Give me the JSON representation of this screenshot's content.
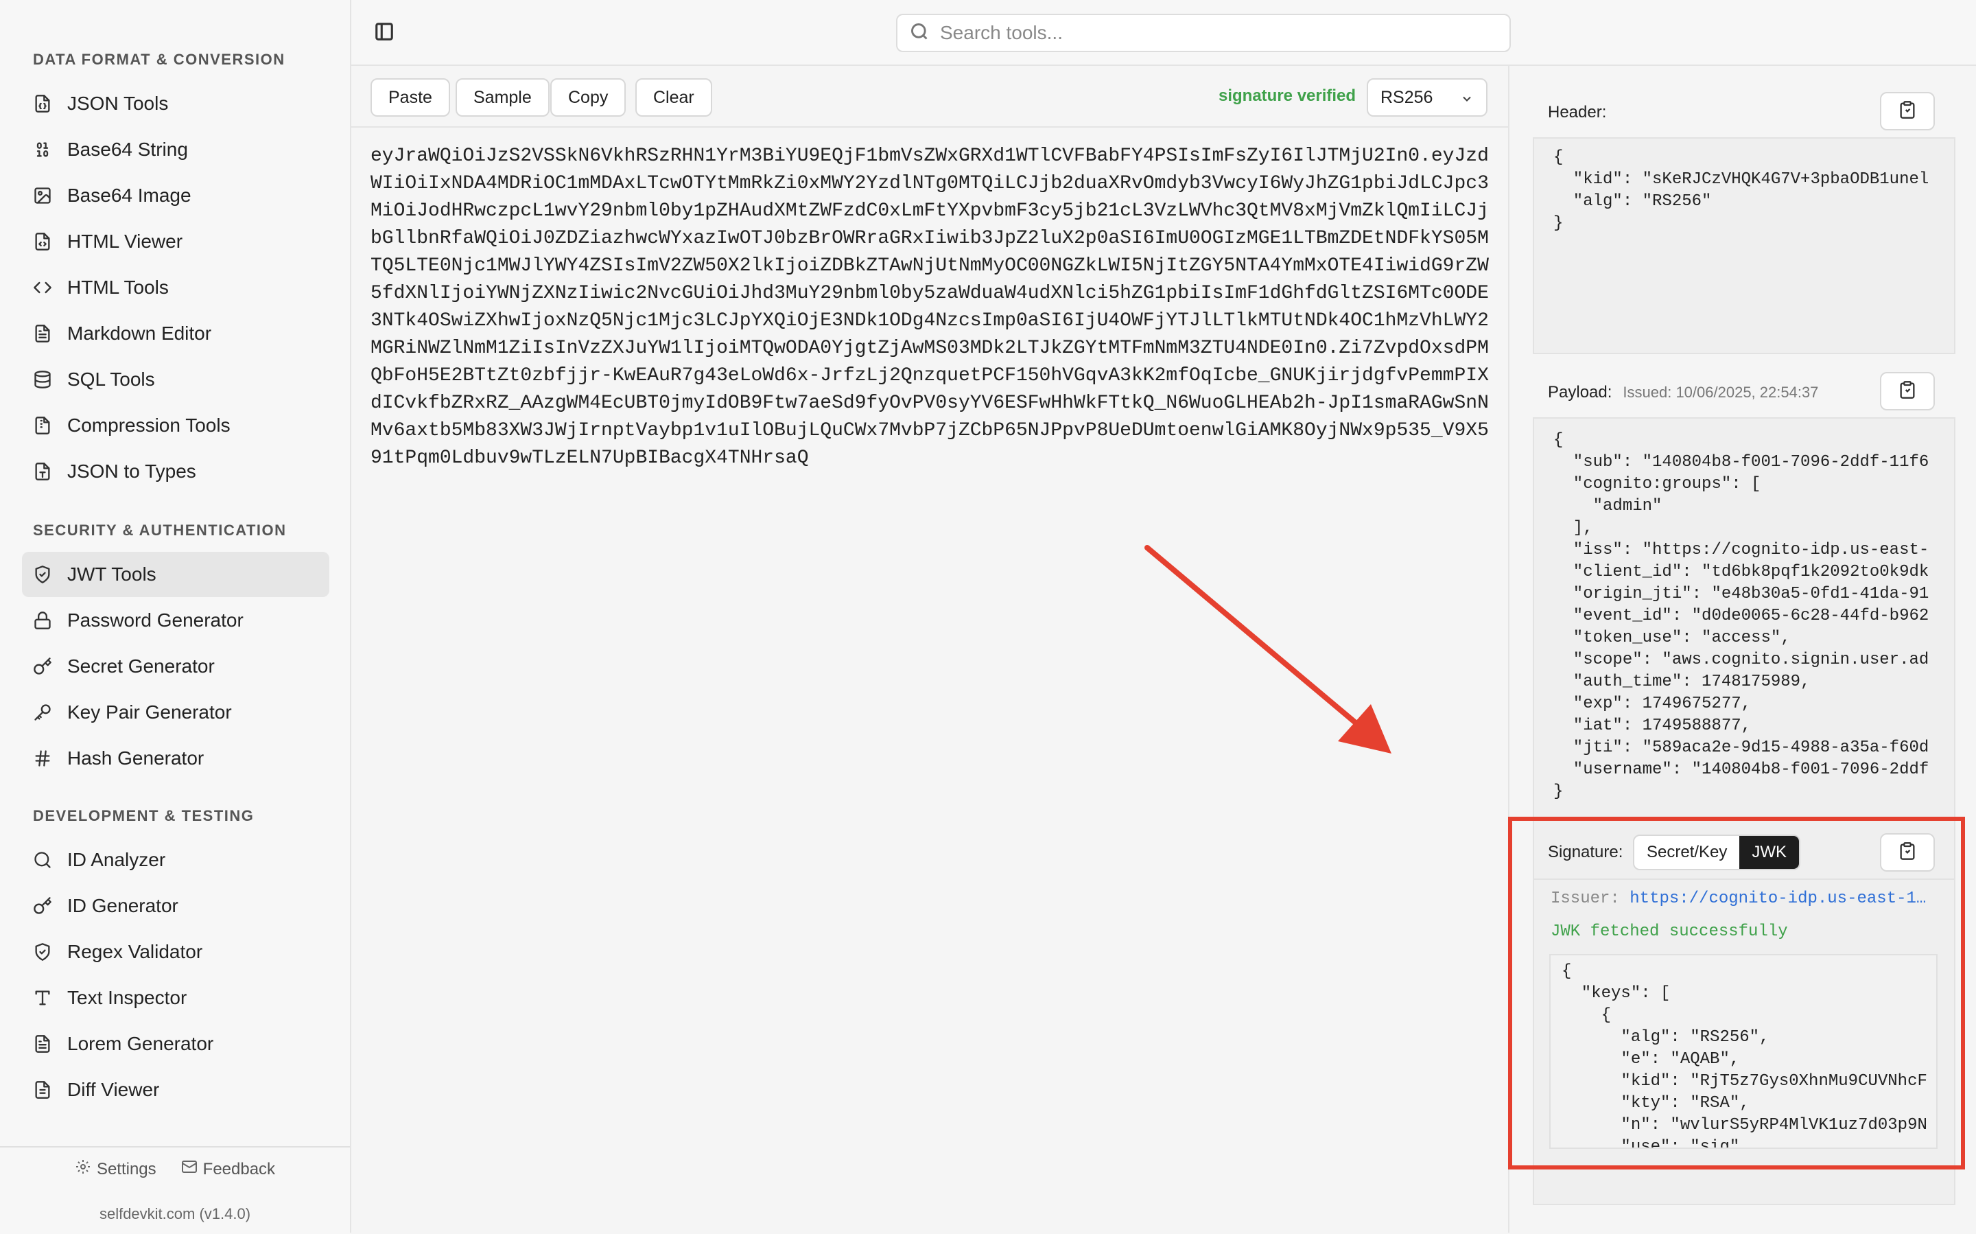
{
  "sidebar": {
    "sections": [
      {
        "title": "DATA FORMAT & CONVERSION",
        "items": [
          {
            "label": "JSON Tools",
            "icon": "file-json-icon"
          },
          {
            "label": "Base64 String",
            "icon": "binary-icon"
          },
          {
            "label": "Base64 Image",
            "icon": "image-icon"
          },
          {
            "label": "HTML Viewer",
            "icon": "file-code-icon"
          },
          {
            "label": "HTML Tools",
            "icon": "code-icon"
          },
          {
            "label": "Markdown Editor",
            "icon": "file-text-icon"
          },
          {
            "label": "SQL Tools",
            "icon": "database-icon"
          },
          {
            "label": "Compression Tools",
            "icon": "archive-icon"
          },
          {
            "label": "JSON to Types",
            "icon": "file-type-icon"
          }
        ]
      },
      {
        "title": "SECURITY & AUTHENTICATION",
        "items": [
          {
            "label": "JWT Tools",
            "icon": "shield-check-icon",
            "active": true
          },
          {
            "label": "Password Generator",
            "icon": "lock-icon"
          },
          {
            "label": "Secret Generator",
            "icon": "key-round-icon"
          },
          {
            "label": "Key Pair Generator",
            "icon": "key-icon"
          },
          {
            "label": "Hash Generator",
            "icon": "hash-icon"
          }
        ]
      },
      {
        "title": "DEVELOPMENT & TESTING",
        "items": [
          {
            "label": "ID Analyzer",
            "icon": "search-icon"
          },
          {
            "label": "ID Generator",
            "icon": "key-round-icon"
          },
          {
            "label": "Regex Validator",
            "icon": "shield-check-icon"
          },
          {
            "label": "Text Inspector",
            "icon": "type-icon"
          },
          {
            "label": "Lorem Generator",
            "icon": "file-text-icon"
          },
          {
            "label": "Diff Viewer",
            "icon": "file-diff-icon"
          }
        ]
      }
    ],
    "footer": {
      "settings": "Settings",
      "feedback": "Feedback",
      "version": "selfdevkit.com (v1.4.0)"
    }
  },
  "search": {
    "placeholder": "Search tools..."
  },
  "toolbar": {
    "paste": "Paste",
    "sample": "Sample",
    "copy": "Copy",
    "clear": "Clear",
    "status": "signature verified",
    "algorithm": "RS256"
  },
  "token": "eyJraWQiOiJzS2VSSkN6VkhRSzRHN1YrM3BiYU9EQjF1bmVsZWxGRXd1WTlCVFBabFY4PSIsImFsZyI6IlJTMjU2In0.eyJzdWIiOiIxNDA4MDRiOC1mMDAxLTcwOTYtMmRkZi0xMWY2YzdlNTg0MTQiLCJjb2duaXRvOmdyb3VwcyI6WyJhZG1pbiJdLCJpc3MiOiJodHRwczpcL1wvY29nbml0by1pZHAudXMtZWFzdC0xLmFtYXpvbmF3cy5jb21cL3VzLWVhc3QtMV8xMjVmZklQmIiLCJjbGllbnRfaWQiOiJ0ZDZiazhwcWYxazIwOTJ0bzBrOWRraGRxIiwib3JpZ2luX2p0aSI6ImU0OGIzMGE1LTBmZDEtNDFkYS05MTQ5LTE0Njc1MWJlYWY4ZSIsImV2ZW50X2lkIjoiZDBkZTAwNjUtNmMyOC00NGZkLWI5NjItZGY5NTA4YmMxOTE4IiwidG9rZW5fdXNlIjoiYWNjZXNzIiwic2NvcGUiOiJhd3MuY29nbml0by5zaWduaW4udXNlci5hZG1pbiIsImF1dGhfdGltZSI6MTc0ODE3NTk4OSwiZXhwIjoxNzQ5Njc1Mjc3LCJpYXQiOjE3NDk1ODg4NzcsImp0aSI6IjU4OWFjYTJlLTlkMTUtNDk4OC1hMzVhLWY2MGRiNWZlNmM1ZiIsInVzZXJuYW1lIjoiMTQwODA0YjgtZjAwMS03MDk2LTJkZGYtMTFmNmM3ZTU4NDE0In0.Zi7ZvpdOxsdPMQbFoH5E2BTtZt0zbfjjr-KwEAuR7g43eLoWd6x-JrfzLj2QnzquetPCF150hVGqvA3kK2mfOqIcbe_GNUKjirjdgfvPemmPIXdICvkfbZRxRZ_AAzgWM4EcUBT0jmyIdOB9Ftw7aeSd9fyOvPV0syYV6ESFwHhWkFTtkQ_N6WuoGLHEAb2h-JpI1smaRAGwSnNMv6axtb5Mb83XW3JWjIrnptVaybp1v1uIlOBujLQuCWx7MvbP7jZCbP65NJPpvP8UeDUmtoenwlGiAMK8OyjNWx9p535_V9X591tPqm0Ldbuv9wTLzELN7UpBIBacgX4TNHrsaQ",
  "header_panel": {
    "label": "Header:",
    "json": "{\n  \"kid\": \"sKeRJCzVHQK4G7V+3pbaODB1unel\n  \"alg\": \"RS256\"\n}"
  },
  "payload_panel": {
    "label": "Payload:",
    "issued": "Issued: 10/06/2025, 22:54:37",
    "json": "{\n  \"sub\": \"140804b8-f001-7096-2ddf-11f6\n  \"cognito:groups\": [\n    \"admin\"\n  ],\n  \"iss\": \"https://cognito-idp.us-east-\n  \"client_id\": \"td6bk8pqf1k2092to0k9dk\n  \"origin_jti\": \"e48b30a5-0fd1-41da-91\n  \"event_id\": \"d0de0065-6c28-44fd-b962\n  \"token_use\": \"access\",\n  \"scope\": \"aws.cognito.signin.user.ad\n  \"auth_time\": 1748175989,\n  \"exp\": 1749675277,\n  \"iat\": 1749588877,\n  \"jti\": \"589aca2e-9d15-4988-a35a-f60d\n  \"username\": \"140804b8-f001-7096-2ddf\n}"
  },
  "signature_panel": {
    "label": "Signature:",
    "tab_secret": "Secret/Key",
    "tab_jwk": "JWK",
    "issuer_label": "Issuer:",
    "issuer_url": "https://cognito-idp.us-east-1…",
    "status": "JWK fetched successfully",
    "jwk_json": "{\n  \"keys\": [\n    {\n      \"alg\": \"RS256\",\n      \"e\": \"AQAB\",\n      \"kid\": \"RjT5z7Gys0XhnMu9CUVNhcF\n      \"kty\": \"RSA\",\n      \"n\": \"wvlurS5yRP4MlVK1uz7d03p9N\n      \"use\": \"sig\""
  },
  "colors": {
    "accent_red": "#e5402f",
    "verified_green": "#3fa14a",
    "link_blue": "#2f6fd6"
  }
}
